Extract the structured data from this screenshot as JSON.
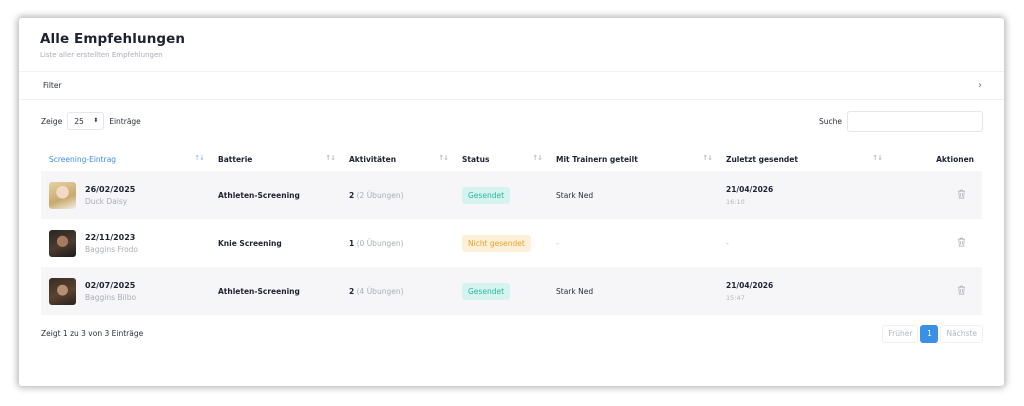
{
  "header": {
    "title": "Alle Empfehlungen",
    "subtitle": "Liste aller erstellten Empfehlungen"
  },
  "filter": {
    "label": "Filter",
    "chevron": "›"
  },
  "length_control": {
    "prefix": "Zeige",
    "value": "25",
    "suffix": "Einträge"
  },
  "search": {
    "label": "Suche",
    "value": "",
    "placeholder": ""
  },
  "columns": [
    {
      "label": "Screening-Eintrag",
      "sortable": true,
      "active": true
    },
    {
      "label": "Batterie",
      "sortable": true
    },
    {
      "label": "Aktivitäten",
      "sortable": true
    },
    {
      "label": "Status",
      "sortable": true
    },
    {
      "label": "Mit Trainern geteilt",
      "sortable": true
    },
    {
      "label": "Zuletzt gesendet",
      "sortable": true
    },
    {
      "label": "Aktionen",
      "sortable": false
    }
  ],
  "sort_icon": "↑↓",
  "rows": [
    {
      "date": "26/02/2025",
      "person": "Duck Daisy",
      "avatar": "avatar-photo",
      "battery": "Athleten-Screening",
      "activities_count": "2",
      "activities_detail": "(2 Übungen)",
      "status": "Gesendet",
      "status_type": "sent",
      "shared_with": "Stark Ned",
      "last_sent_date": "21/04/2026",
      "last_sent_time": "16:10",
      "action_icon": "trash-icon"
    },
    {
      "date": "22/11/2023",
      "person": "Baggins Frodo",
      "avatar": "avatar-photo",
      "battery": "Knie Screening",
      "activities_count": "1",
      "activities_detail": "(0 Übungen)",
      "status": "Nicht gesendet",
      "status_type": "not-sent",
      "shared_with": "-",
      "last_sent_date": "-",
      "last_sent_time": "",
      "action_icon": "trash-icon"
    },
    {
      "date": "02/07/2025",
      "person": "Baggins Bilbo",
      "avatar": "avatar-photo",
      "battery": "Athleten-Screening",
      "activities_count": "2",
      "activities_detail": "(4 Übungen)",
      "status": "Gesendet",
      "status_type": "sent",
      "shared_with": "Stark Ned",
      "last_sent_date": "21/04/2026",
      "last_sent_time": "15:47",
      "action_icon": "trash-icon"
    }
  ],
  "footer": {
    "info": "Zeigt 1 zu 3 von 3 Einträge",
    "prev": "Früher",
    "current_page": "1",
    "next": "Nächste"
  },
  "colors": {
    "accent": "#3b8fe4",
    "status_sent_bg": "#d6f4ef",
    "status_sent_text": "#27b7a0",
    "status_not_sent_bg": "#fdf0d8",
    "status_not_sent_text": "#f0a12a"
  }
}
